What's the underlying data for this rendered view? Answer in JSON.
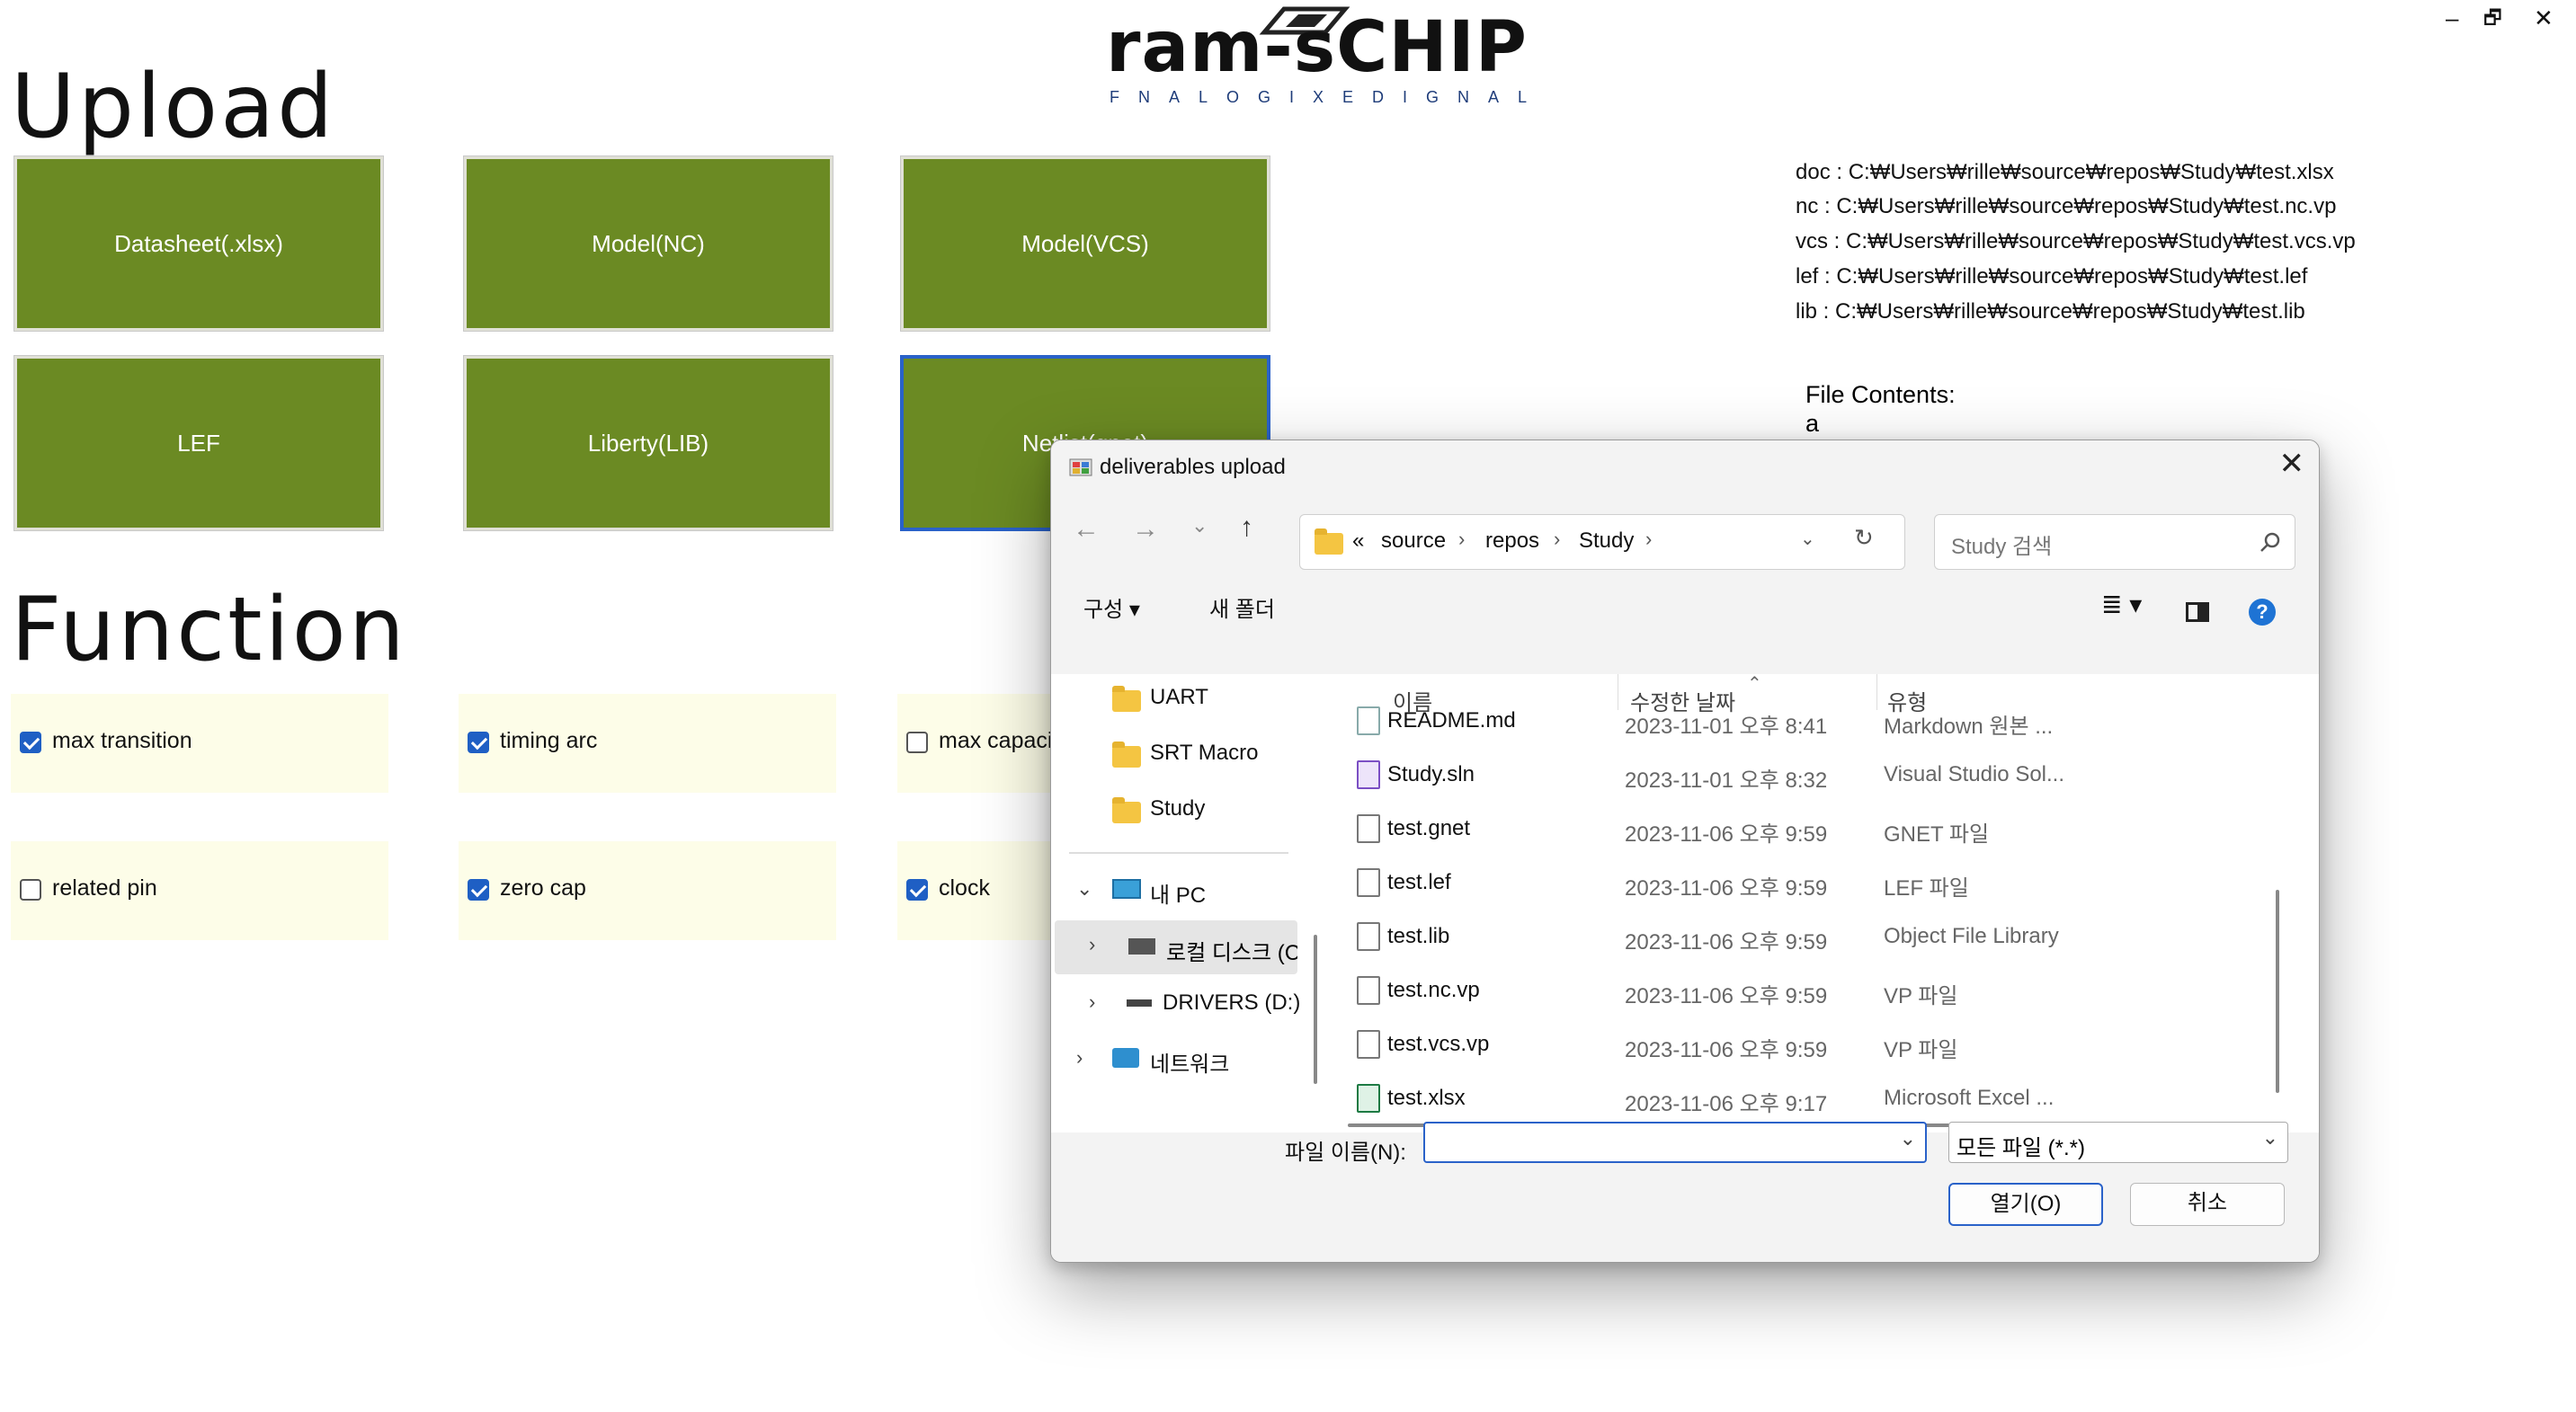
{
  "app": {
    "window_controls": [
      "–",
      "🗗",
      "✕"
    ],
    "logo_main": "ram-sCHIP",
    "logo_sub": "FNALOGIXEDIGNAL"
  },
  "upload": {
    "title": "Upload",
    "buttons": [
      "Datasheet(.xlsx)",
      "Model(NC)",
      "Model(VCS)",
      "LEF",
      "Liberty(LIB)",
      "Netlist(gnet)"
    ]
  },
  "function": {
    "title": "Function",
    "checks": [
      {
        "label": "max transition",
        "checked": true
      },
      {
        "label": "timing arc",
        "checked": true
      },
      {
        "label": "max capacitance",
        "checked": false
      },
      {
        "label": "related pin",
        "checked": false
      },
      {
        "label": "zero cap",
        "checked": true
      },
      {
        "label": "clock",
        "checked": true
      }
    ]
  },
  "paths": [
    "doc : C:₩Users₩rille₩source₩repos₩Study₩test.xlsx",
    "nc : C:₩Users₩rille₩source₩repos₩Study₩test.nc.vp",
    "vcs : C:₩Users₩rille₩source₩repos₩Study₩test.vcs.vp",
    "lef : C:₩Users₩rille₩source₩repos₩Study₩test.lef",
    "lib : C:₩Users₩rille₩source₩repos₩Study₩test.lib"
  ],
  "file_contents": {
    "label": "File Contents:",
    "value": "a"
  },
  "dialog": {
    "title": "deliverables upload",
    "close": "✕",
    "breadcrumb": [
      "«",
      "source",
      "repos",
      "Study"
    ],
    "search_placeholder": "Study 검색",
    "organize": "구성",
    "new_folder": "새 폴더",
    "help": "?",
    "nav_items": [
      {
        "label": "UART",
        "kind": "folder"
      },
      {
        "label": "SRT Macro",
        "kind": "folder"
      },
      {
        "label": "Study",
        "kind": "folder"
      },
      {
        "label": "내 PC",
        "kind": "pc"
      },
      {
        "label": "로컬 디스크 (C:)",
        "kind": "disk"
      },
      {
        "label": "DRIVERS (D:)",
        "kind": "drive"
      },
      {
        "label": "네트워크",
        "kind": "network"
      }
    ],
    "columns": {
      "name": "이름",
      "date": "수정한 날짜",
      "type": "유형"
    },
    "files": [
      {
        "name": "README.md",
        "date": "2023-11-01 오후 8:41",
        "type": "Markdown 원본 ..."
      },
      {
        "name": "Study.sln",
        "date": "2023-11-01 오후 8:32",
        "type": "Visual Studio Sol..."
      },
      {
        "name": "test.gnet",
        "date": "2023-11-06 오후 9:59",
        "type": "GNET 파일"
      },
      {
        "name": "test.lef",
        "date": "2023-11-06 오후 9:59",
        "type": "LEF 파일"
      },
      {
        "name": "test.lib",
        "date": "2023-11-06 오후 9:59",
        "type": "Object File Library"
      },
      {
        "name": "test.nc.vp",
        "date": "2023-11-06 오후 9:59",
        "type": "VP 파일"
      },
      {
        "name": "test.vcs.vp",
        "date": "2023-11-06 오후 9:59",
        "type": "VP 파일"
      },
      {
        "name": "test.xlsx",
        "date": "2023-11-06 오후 9:17",
        "type": "Microsoft Excel ..."
      }
    ],
    "filename_label": "파일 이름(N):",
    "filename_value": "",
    "filter_value": "모든 파일 (*.*)",
    "open_label": "열기(O)",
    "cancel_label": "취소"
  },
  "colors": {
    "upload_button": "#6b8a23",
    "function_cell": "#fdfde8",
    "checkbox_checked": "#1f5fc4",
    "focus": "#2a62c9"
  }
}
